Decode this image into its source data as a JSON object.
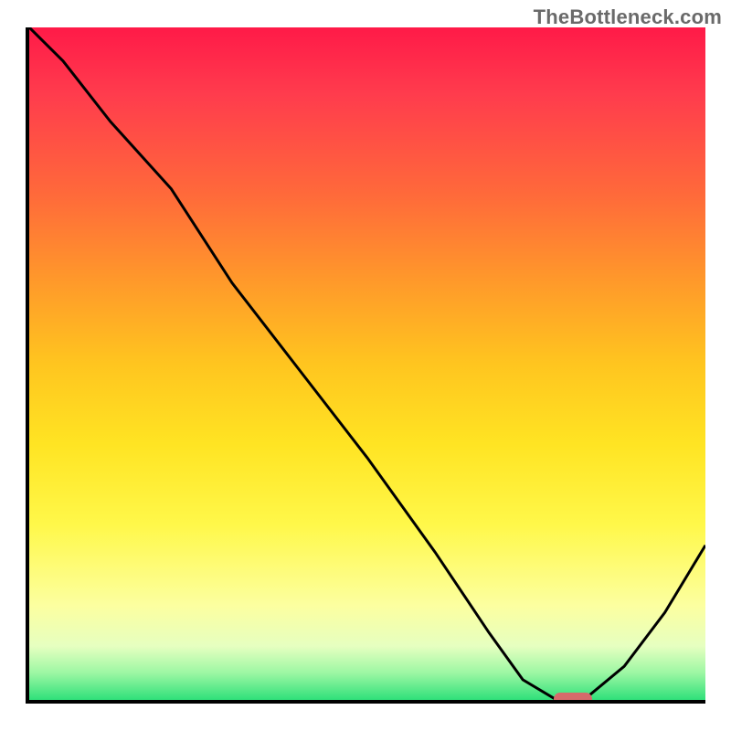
{
  "watermark": "TheBottleneck.com",
  "chart_data": {
    "type": "line",
    "title": "",
    "xlabel": "",
    "ylabel": "",
    "x_range_fraction": [
      0,
      1
    ],
    "ylim": [
      0,
      100
    ],
    "series": [
      {
        "name": "bottleneck-curve",
        "x_fraction": [
          0.0,
          0.05,
          0.12,
          0.21,
          0.3,
          0.4,
          0.5,
          0.6,
          0.68,
          0.73,
          0.78,
          0.82,
          0.88,
          0.94,
          1.0
        ],
        "y_value": [
          100,
          95,
          86,
          76,
          62,
          49,
          36,
          22,
          10,
          3,
          0,
          0,
          5,
          13,
          23
        ]
      }
    ],
    "optimal_marker": {
      "x_fraction": 0.8,
      "y_value": 0
    },
    "colors": {
      "axis": "#000000",
      "curve": "#000000",
      "marker": "#d66b6b",
      "gradient_top": "#ff1a48",
      "gradient_mid": "#ffe423",
      "gradient_bottom": "#2fe07a"
    },
    "notes": "Axes carry no tick labels or numeric markings in the source image; y treated as bottleneck percentage (100 = worst at top-red, 0 = best at bottom-green), x as normalized configuration range."
  }
}
